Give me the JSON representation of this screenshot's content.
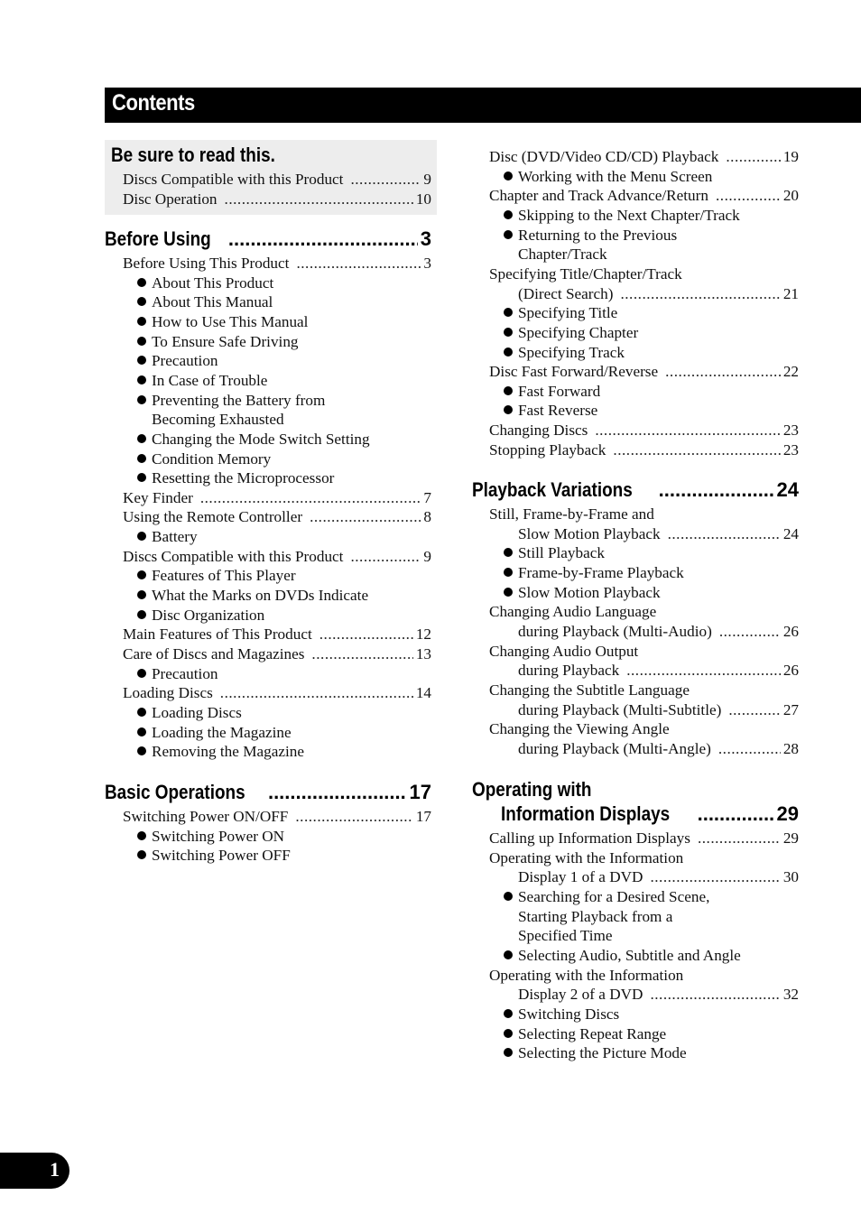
{
  "title": "Contents",
  "page_number": "1",
  "be_sure": {
    "heading": "Be sure to read this.",
    "entries": [
      {
        "label": "Discs Compatible with this Product",
        "page": "9"
      },
      {
        "label": "Disc Operation",
        "page": "10"
      }
    ]
  },
  "sections": {
    "before_using": {
      "heading": "Before Using",
      "page": "3"
    },
    "basic_operations": {
      "heading": "Basic Operations",
      "page": "17"
    },
    "playback_variations": {
      "heading": "Playback Variations",
      "page": "24"
    },
    "operating_info": {
      "heading_line1": "Operating with",
      "heading_line2": "Information Displays",
      "page": "29"
    }
  },
  "left_lines": [
    {
      "type": "entry",
      "label": "Before Using This Product",
      "page": "3"
    },
    {
      "type": "bullet",
      "label": "About This Product"
    },
    {
      "type": "bullet",
      "label": "About This Manual"
    },
    {
      "type": "bullet",
      "label": "How to Use This Manual"
    },
    {
      "type": "bullet",
      "label": "To Ensure Safe Driving"
    },
    {
      "type": "bullet",
      "label": "Precaution"
    },
    {
      "type": "bullet",
      "label": "In Case of Trouble"
    },
    {
      "type": "bullet",
      "label": "Preventing the Battery from"
    },
    {
      "type": "cont",
      "label": "Becoming Exhausted"
    },
    {
      "type": "bullet",
      "label": "Changing the Mode Switch Setting"
    },
    {
      "type": "bullet",
      "label": "Condition Memory"
    },
    {
      "type": "bullet",
      "label": "Resetting the Microprocessor"
    },
    {
      "type": "entry",
      "label": "Key Finder",
      "page": "7"
    },
    {
      "type": "entry",
      "label": "Using the Remote Controller",
      "page": "8"
    },
    {
      "type": "bullet",
      "label": "Battery"
    },
    {
      "type": "entry",
      "label": "Discs Compatible with this Product",
      "page": "9"
    },
    {
      "type": "bullet",
      "label": "Features of This Player"
    },
    {
      "type": "bullet",
      "label": "What the Marks on DVDs Indicate"
    },
    {
      "type": "bullet",
      "label": "Disc Organization"
    },
    {
      "type": "entry",
      "label": "Main Features of This Product",
      "page": "12"
    },
    {
      "type": "entry",
      "label": "Care of Discs and Magazines",
      "page": "13"
    },
    {
      "type": "bullet",
      "label": "Precaution"
    },
    {
      "type": "entry",
      "label": "Loading Discs",
      "page": "14"
    },
    {
      "type": "bullet",
      "label": "Loading Discs"
    },
    {
      "type": "bullet",
      "label": "Loading the Magazine"
    },
    {
      "type": "bullet",
      "label": "Removing the Magazine"
    }
  ],
  "basic_lines": [
    {
      "type": "entry",
      "label": "Switching Power ON/OFF",
      "page": "17"
    },
    {
      "type": "bullet",
      "label": "Switching Power ON"
    },
    {
      "type": "bullet",
      "label": "Switching Power OFF"
    }
  ],
  "right_top_lines": [
    {
      "type": "entry",
      "label": "Disc (DVD/Video CD/CD) Playback",
      "page": "19"
    },
    {
      "type": "bullet",
      "label": "Working with the Menu Screen"
    },
    {
      "type": "entry",
      "label": "Chapter and Track Advance/Return",
      "page": "20"
    },
    {
      "type": "bullet",
      "label": "Skipping to the Next Chapter/Track"
    },
    {
      "type": "bullet",
      "label": "Returning to the Previous"
    },
    {
      "type": "cont",
      "label": "Chapter/Track"
    },
    {
      "type": "plain",
      "label": "Specifying Title/Chapter/Track"
    },
    {
      "type": "subentry",
      "label": "(Direct Search)",
      "page": "21"
    },
    {
      "type": "bullet",
      "label": "Specifying Title"
    },
    {
      "type": "bullet",
      "label": "Specifying Chapter"
    },
    {
      "type": "bullet",
      "label": "Specifying Track"
    },
    {
      "type": "entry",
      "label": "Disc Fast Forward/Reverse",
      "page": "22"
    },
    {
      "type": "bullet",
      "label": "Fast Forward"
    },
    {
      "type": "bullet",
      "label": "Fast Reverse"
    },
    {
      "type": "entry",
      "label": "Changing Discs",
      "page": "23"
    },
    {
      "type": "entry",
      "label": "Stopping Playback",
      "page": "23"
    }
  ],
  "playback_lines": [
    {
      "type": "plain",
      "label": "Still, Frame-by-Frame and"
    },
    {
      "type": "subentry",
      "label": "Slow Motion Playback",
      "page": "24"
    },
    {
      "type": "bullet",
      "label": "Still Playback"
    },
    {
      "type": "bullet",
      "label": "Frame-by-Frame Playback"
    },
    {
      "type": "bullet",
      "label": "Slow Motion Playback"
    },
    {
      "type": "plain",
      "label": "Changing Audio Language"
    },
    {
      "type": "subentry",
      "label": "during Playback (Multi-Audio)",
      "page": "26"
    },
    {
      "type": "plain",
      "label": "Changing Audio Output"
    },
    {
      "type": "subentry",
      "label": "during Playback",
      "page": "26"
    },
    {
      "type": "plain",
      "label": "Changing the Subtitle Language"
    },
    {
      "type": "subentry",
      "label": "during Playback (Multi-Subtitle)",
      "page": "27"
    },
    {
      "type": "plain",
      "label": "Changing the Viewing Angle"
    },
    {
      "type": "subentry",
      "label": "during Playback (Multi-Angle)",
      "page": "28"
    }
  ],
  "info_lines": [
    {
      "type": "entry",
      "label": "Calling up Information Displays",
      "page": "29"
    },
    {
      "type": "plain",
      "label": "Operating with the Information"
    },
    {
      "type": "subentry",
      "label": "Display 1 of a DVD",
      "page": "30"
    },
    {
      "type": "bullet",
      "label": "Searching for a Desired Scene,"
    },
    {
      "type": "cont",
      "label": "Starting Playback from a"
    },
    {
      "type": "cont",
      "label": "Specified Time"
    },
    {
      "type": "bullet",
      "label": "Selecting Audio, Subtitle and Angle"
    },
    {
      "type": "plain",
      "label": "Operating with the Information"
    },
    {
      "type": "subentry",
      "label": "Display 2 of a DVD",
      "page": "32"
    },
    {
      "type": "bullet",
      "label": "Switching Discs"
    },
    {
      "type": "bullet",
      "label": "Selecting Repeat Range"
    },
    {
      "type": "bullet",
      "label": "Selecting the Picture Mode"
    }
  ]
}
